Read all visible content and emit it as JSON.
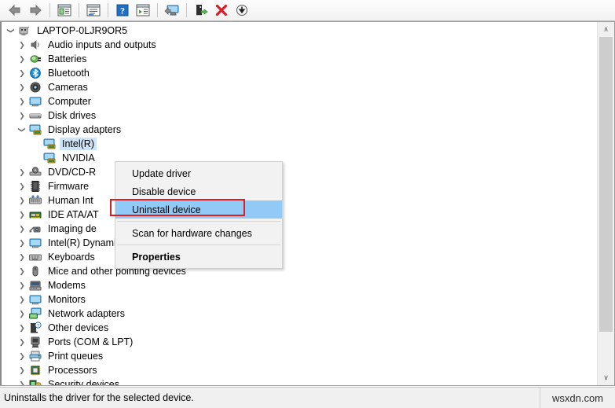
{
  "toolbar": {
    "buttons": [
      {
        "name": "back-button",
        "icon": "back-arrow-icon",
        "label": "Back"
      },
      {
        "name": "forward-button",
        "icon": "forward-arrow-icon",
        "label": "Forward"
      },
      {
        "name": "show-hide-console-tree-button",
        "icon": "console-tree-icon",
        "label": "Show/Hide Console Tree"
      },
      {
        "name": "properties-button",
        "icon": "properties-window-icon",
        "label": "Properties"
      },
      {
        "name": "help-button",
        "icon": "help-question-icon",
        "label": "Help"
      },
      {
        "name": "scan-for-hardware-changes-button",
        "icon": "scan-hardware-icon",
        "label": "Scan for hardware changes"
      },
      {
        "name": "update-driver-button",
        "icon": "update-driver-monitor-icon",
        "label": "Update driver"
      },
      {
        "name": "enable-device-button",
        "icon": "enable-device-icon",
        "label": "Enable device"
      },
      {
        "name": "uninstall-device-button",
        "icon": "uninstall-red-x-icon",
        "label": "Uninstall device"
      },
      {
        "name": "disable-device-button",
        "icon": "disable-device-down-arrow-icon",
        "label": "Disable device"
      }
    ]
  },
  "tree": {
    "items": [
      {
        "label": "LAPTOP-0LJR9OR5",
        "level": 0,
        "expanded": true,
        "icon": "computer-node-icon",
        "selected": false
      },
      {
        "label": "Audio inputs and outputs",
        "level": 1,
        "expanded": false,
        "icon": "speaker-icon",
        "selected": false
      },
      {
        "label": "Batteries",
        "level": 1,
        "expanded": false,
        "icon": "battery-icon",
        "selected": false
      },
      {
        "label": "Bluetooth",
        "level": 1,
        "expanded": false,
        "icon": "bluetooth-icon",
        "selected": false
      },
      {
        "label": "Cameras",
        "level": 1,
        "expanded": false,
        "icon": "camera-icon",
        "selected": false
      },
      {
        "label": "Computer",
        "level": 1,
        "expanded": false,
        "icon": "monitor-icon",
        "selected": false
      },
      {
        "label": "Disk drives",
        "level": 1,
        "expanded": false,
        "icon": "disk-drive-icon",
        "selected": false
      },
      {
        "label": "Display adapters",
        "level": 1,
        "expanded": true,
        "icon": "display-adapter-icon",
        "selected": false
      },
      {
        "label": "Intel(R)",
        "level": 2,
        "expanded": null,
        "icon": "display-adapter-icon",
        "selected": true
      },
      {
        "label": "NVIDIA",
        "level": 2,
        "expanded": null,
        "icon": "display-adapter-icon",
        "selected": false
      },
      {
        "label": "DVD/CD-R",
        "level": 1,
        "expanded": false,
        "icon": "dvd-drive-icon",
        "selected": false
      },
      {
        "label": "Firmware",
        "level": 1,
        "expanded": false,
        "icon": "firmware-chip-icon",
        "selected": false
      },
      {
        "label": "Human Int",
        "level": 1,
        "expanded": false,
        "icon": "human-interface-icon",
        "selected": false
      },
      {
        "label": "IDE ATA/AT",
        "level": 1,
        "expanded": false,
        "icon": "ide-controller-icon",
        "selected": false
      },
      {
        "label": "Imaging de",
        "level": 1,
        "expanded": false,
        "icon": "imaging-device-icon",
        "selected": false
      },
      {
        "label": "Intel(R) Dynamic Platform and Thermal Framework",
        "level": 1,
        "expanded": false,
        "icon": "monitor-icon",
        "selected": false
      },
      {
        "label": "Keyboards",
        "level": 1,
        "expanded": false,
        "icon": "keyboard-icon",
        "selected": false
      },
      {
        "label": "Mice and other pointing devices",
        "level": 1,
        "expanded": false,
        "icon": "mouse-icon",
        "selected": false
      },
      {
        "label": "Modems",
        "level": 1,
        "expanded": false,
        "icon": "modem-icon",
        "selected": false
      },
      {
        "label": "Monitors",
        "level": 1,
        "expanded": false,
        "icon": "monitor-icon",
        "selected": false
      },
      {
        "label": "Network adapters",
        "level": 1,
        "expanded": false,
        "icon": "network-adapter-icon",
        "selected": false
      },
      {
        "label": "Other devices",
        "level": 1,
        "expanded": false,
        "icon": "other-device-question-icon",
        "selected": false
      },
      {
        "label": "Ports (COM & LPT)",
        "level": 1,
        "expanded": false,
        "icon": "port-icon",
        "selected": false
      },
      {
        "label": "Print queues",
        "level": 1,
        "expanded": false,
        "icon": "printer-icon",
        "selected": false
      },
      {
        "label": "Processors",
        "level": 1,
        "expanded": false,
        "icon": "processor-icon",
        "selected": false
      },
      {
        "label": "Security devices",
        "level": 1,
        "expanded": false,
        "icon": "security-device-icon",
        "selected": false
      }
    ]
  },
  "context_menu": {
    "items": [
      {
        "label": "Update driver",
        "type": "item",
        "highlighted": false,
        "bold": false
      },
      {
        "label": "Disable device",
        "type": "item",
        "highlighted": false,
        "bold": false
      },
      {
        "label": "Uninstall device",
        "type": "item",
        "highlighted": true,
        "bold": false
      },
      {
        "label": "",
        "type": "separator",
        "highlighted": false,
        "bold": false
      },
      {
        "label": "Scan for hardware changes",
        "type": "item",
        "highlighted": false,
        "bold": false
      },
      {
        "label": "",
        "type": "separator",
        "highlighted": false,
        "bold": false
      },
      {
        "label": "Properties",
        "type": "item",
        "highlighted": false,
        "bold": true
      }
    ]
  },
  "statusbar": {
    "text": "Uninstalls the driver for the selected device.",
    "watermark": "wsxdn.com"
  },
  "scrollbar": {
    "up_arrow": "∧",
    "down_arrow": "∨"
  },
  "colors": {
    "selection_blue": "#cce4f7",
    "menu_highlight": "#91c9f7",
    "annotation_red": "#e01c20",
    "toolbar_bg": "#f2f2f2"
  }
}
